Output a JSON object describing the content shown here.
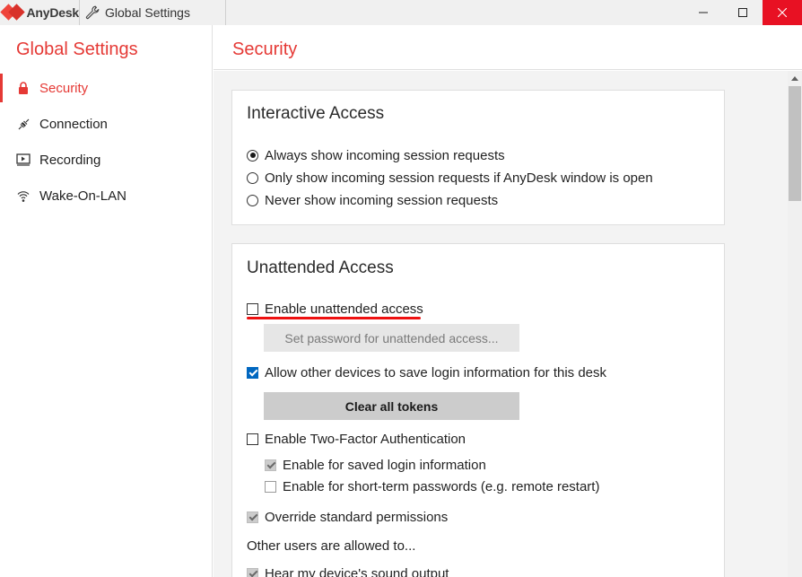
{
  "titlebar": {
    "app_name": "AnyDesk",
    "tab_title": "Global Settings"
  },
  "sidebar": {
    "title": "Global Settings",
    "items": [
      {
        "label": "Security",
        "icon": "lock-icon",
        "active": true
      },
      {
        "label": "Connection",
        "icon": "connection-plug-icon",
        "active": false
      },
      {
        "label": "Recording",
        "icon": "recording-play-icon",
        "active": false
      },
      {
        "label": "Wake-On-LAN",
        "icon": "wifi-wake-icon",
        "active": false
      }
    ]
  },
  "main": {
    "title": "Security"
  },
  "interactive_access": {
    "title": "Interactive Access",
    "options": [
      {
        "label": "Always show incoming session requests",
        "selected": true
      },
      {
        "label": "Only show incoming session requests if AnyDesk window is open",
        "selected": false
      },
      {
        "label": "Never show incoming session requests",
        "selected": false
      }
    ]
  },
  "unattended_access": {
    "title": "Unattended Access",
    "enable_label": "Enable unattended access",
    "set_password_label": "Set password for unattended access...",
    "allow_save_login_label": "Allow other devices to save login information for this desk",
    "clear_tokens_label": "Clear all tokens",
    "two_factor_label": "Enable Two-Factor Authentication",
    "saved_login_label": "Enable for saved login information",
    "short_term_label": "Enable for short-term passwords (e.g. remote restart)",
    "override_label": "Override standard permissions",
    "other_users_label": "Other users are allowed to...",
    "hear_sound_label": "Hear my device's sound output"
  },
  "colors": {
    "accent": "#e53935",
    "checkbox_blue": "#0067c0",
    "close_red": "#e81123"
  }
}
